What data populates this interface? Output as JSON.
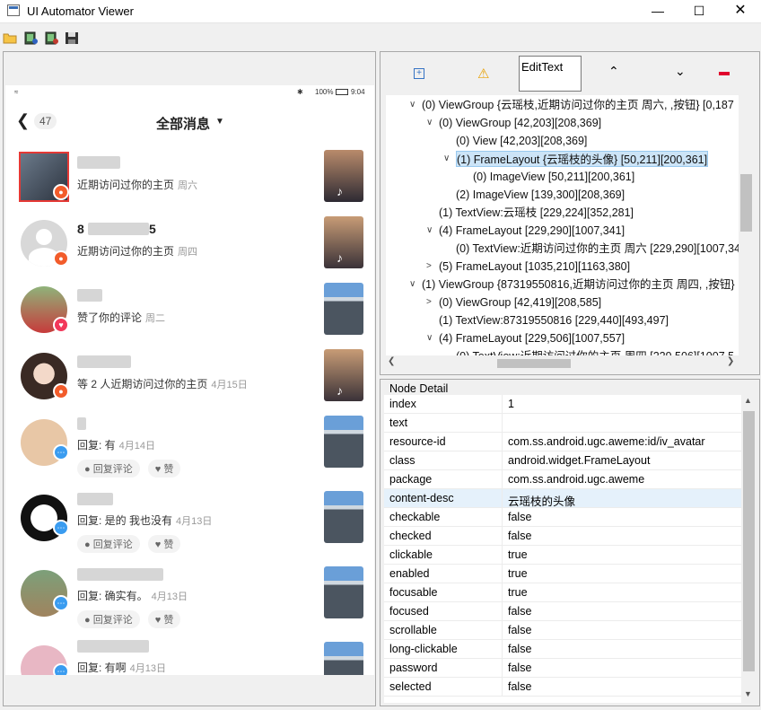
{
  "window": {
    "title": "UI Automator Viewer"
  },
  "toolbar_icons": [
    "open-folder-icon",
    "screenshot-icon",
    "screenshot-compressed-icon",
    "save-icon"
  ],
  "tree_toolbar": {
    "search_value": "EditText"
  },
  "phone": {
    "battery": "100%",
    "clock": "9:04",
    "back_count": "47",
    "header_title": "全部消息",
    "rows": [
      {
        "name": "",
        "message": "近期访问过你的主页",
        "time": "周六",
        "badge": "people",
        "actions": []
      },
      {
        "name": "8",
        "name_tail": "5",
        "message": "近期访问过你的主页",
        "time": "周四",
        "badge": "people",
        "actions": []
      },
      {
        "name": "",
        "message": "赞了你的评论",
        "time": "周二",
        "badge": "heart",
        "actions": []
      },
      {
        "name": "",
        "message": "等 2 人近期访问过你的主页",
        "time": "4月15日",
        "badge": "people",
        "actions": []
      },
      {
        "name": "",
        "message": "回复: 有",
        "time": "4月14日",
        "badge": "chat",
        "actions": [
          "回复评论",
          "赞"
        ]
      },
      {
        "name": "",
        "message": "回复: 是的 我也没有",
        "time": "4月13日",
        "badge": "chat",
        "actions": [
          "回复评论",
          "赞"
        ]
      },
      {
        "name": "",
        "message": "回复: 确实有。",
        "time": "4月13日",
        "badge": "chat",
        "actions": [
          "回复评论",
          "赞"
        ]
      },
      {
        "name": "",
        "message": "回复: 有啊",
        "time": "4月13日",
        "badge": "chat",
        "actions": []
      }
    ]
  },
  "tree": [
    {
      "text": "(0) ViewGroup {云瑶枝,近期访问过你的主页 周六, ,按钮} [0,187",
      "indent": 0,
      "arrow": "down"
    },
    {
      "text": "(0) ViewGroup [42,203][208,369]",
      "indent": 1,
      "arrow": "down"
    },
    {
      "text": "(0) View [42,203][208,369]",
      "indent": 2,
      "arrow": ""
    },
    {
      "text": "(1) FrameLayout {云瑶枝的头像} [50,211][200,361]",
      "indent": 2,
      "arrow": "down",
      "selected": true
    },
    {
      "text": "(0) ImageView [50,211][200,361]",
      "indent": 3,
      "arrow": ""
    },
    {
      "text": "(2) ImageView [139,300][208,369]",
      "indent": 2,
      "arrow": ""
    },
    {
      "text": "(1) TextView:云瑶枝 [229,224][352,281]",
      "indent": 1,
      "arrow": ""
    },
    {
      "text": "(4) FrameLayout [229,290][1007,341]",
      "indent": 1,
      "arrow": "down"
    },
    {
      "text": "(0) TextView:近期访问过你的主页 周六 [229,290][1007,34",
      "indent": 2,
      "arrow": ""
    },
    {
      "text": "(5) FrameLayout [1035,210][1163,380]",
      "indent": 1,
      "arrow": "right"
    },
    {
      "text": "(1) ViewGroup {87319550816,近期访问过你的主页 周四, ,按钮}",
      "indent": 0,
      "arrow": "down"
    },
    {
      "text": "(0) ViewGroup [42,419][208,585]",
      "indent": 1,
      "arrow": "right"
    },
    {
      "text": "(1) TextView:87319550816 [229,440][493,497]",
      "indent": 1,
      "arrow": ""
    },
    {
      "text": "(4) FrameLayout [229,506][1007,557]",
      "indent": 1,
      "arrow": "down"
    },
    {
      "text": "(0) TextView:近期访问过你的主页 周四 [229,506][1007,5",
      "indent": 2,
      "arrow": ""
    }
  ],
  "node_detail": {
    "title": "Node Detail",
    "rows": [
      {
        "key": "index",
        "value": "1"
      },
      {
        "key": "text",
        "value": ""
      },
      {
        "key": "resource-id",
        "value": "com.ss.android.ugc.aweme:id/iv_avatar"
      },
      {
        "key": "class",
        "value": "android.widget.FrameLayout"
      },
      {
        "key": "package",
        "value": "com.ss.android.ugc.aweme"
      },
      {
        "key": "content-desc",
        "value": "云瑶枝的头像",
        "highlight": true
      },
      {
        "key": "checkable",
        "value": "false"
      },
      {
        "key": "checked",
        "value": "false"
      },
      {
        "key": "clickable",
        "value": "true"
      },
      {
        "key": "enabled",
        "value": "true"
      },
      {
        "key": "focusable",
        "value": "true"
      },
      {
        "key": "focused",
        "value": "false"
      },
      {
        "key": "scrollable",
        "value": "false"
      },
      {
        "key": "long-clickable",
        "value": "false"
      },
      {
        "key": "password",
        "value": "false"
      },
      {
        "key": "selected",
        "value": "false"
      }
    ]
  },
  "colors": {
    "accent_red": "#e53935",
    "badge_orange": "#f25c2b",
    "badge_heart": "#f2385a",
    "badge_chat": "#3a9cf0",
    "selection": "#cce4f7"
  }
}
